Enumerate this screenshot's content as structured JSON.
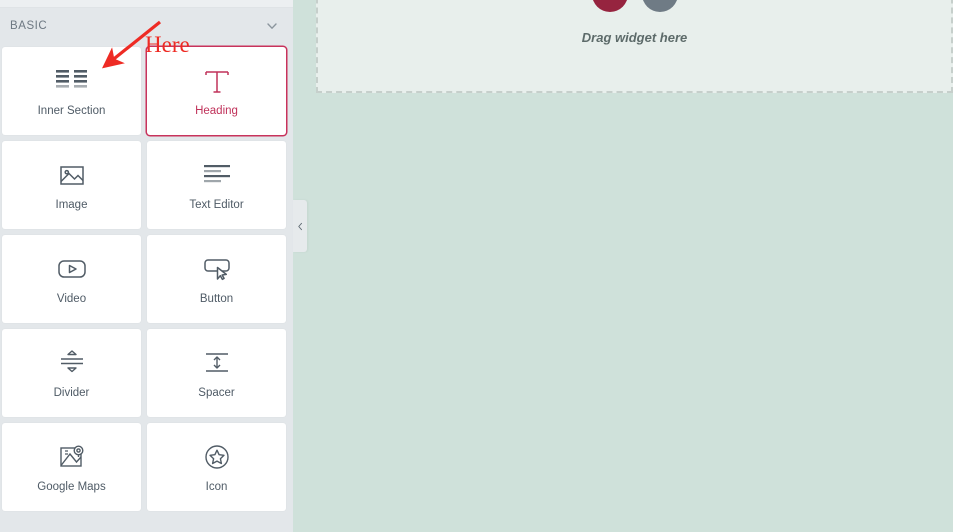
{
  "panel": {
    "category": {
      "label": "BASIC",
      "collapse_icon": "chevron-down-icon"
    },
    "widgets": [
      {
        "label": "Inner Section",
        "icon": "inner-section-icon",
        "highlighted": false
      },
      {
        "label": "Heading",
        "icon": "heading-icon",
        "highlighted": true
      },
      {
        "label": "Image",
        "icon": "image-icon",
        "highlighted": false
      },
      {
        "label": "Text Editor",
        "icon": "text-editor-icon",
        "highlighted": false
      },
      {
        "label": "Video",
        "icon": "video-icon",
        "highlighted": false
      },
      {
        "label": "Button",
        "icon": "button-icon",
        "highlighted": false
      },
      {
        "label": "Divider",
        "icon": "divider-icon",
        "highlighted": false
      },
      {
        "label": "Spacer",
        "icon": "spacer-icon",
        "highlighted": false
      },
      {
        "label": "Google Maps",
        "icon": "google-maps-icon",
        "highlighted": false
      },
      {
        "label": "Icon",
        "icon": "star-icon",
        "highlighted": false
      }
    ],
    "collapse_handle_icon": "chevron-left-icon"
  },
  "canvas": {
    "drag_hint": "Drag widget here",
    "social_icons": [
      {
        "name": "facebook-icon",
        "color": "#96243f"
      },
      {
        "name": "envelope-icon",
        "color": "#6f7b85"
      }
    ]
  },
  "annotation": {
    "label": "Here",
    "color": "#ee2b24",
    "arrow_icon": "arrow-pointer"
  },
  "colors": {
    "panel_bg": "#e3e7ea",
    "tile_bg": "#ffffff",
    "highlight": "#c0325a",
    "canvas_bg": "#cfe1da",
    "drop_bg": "#e8efec",
    "annotation_red": "#ee2b24"
  }
}
